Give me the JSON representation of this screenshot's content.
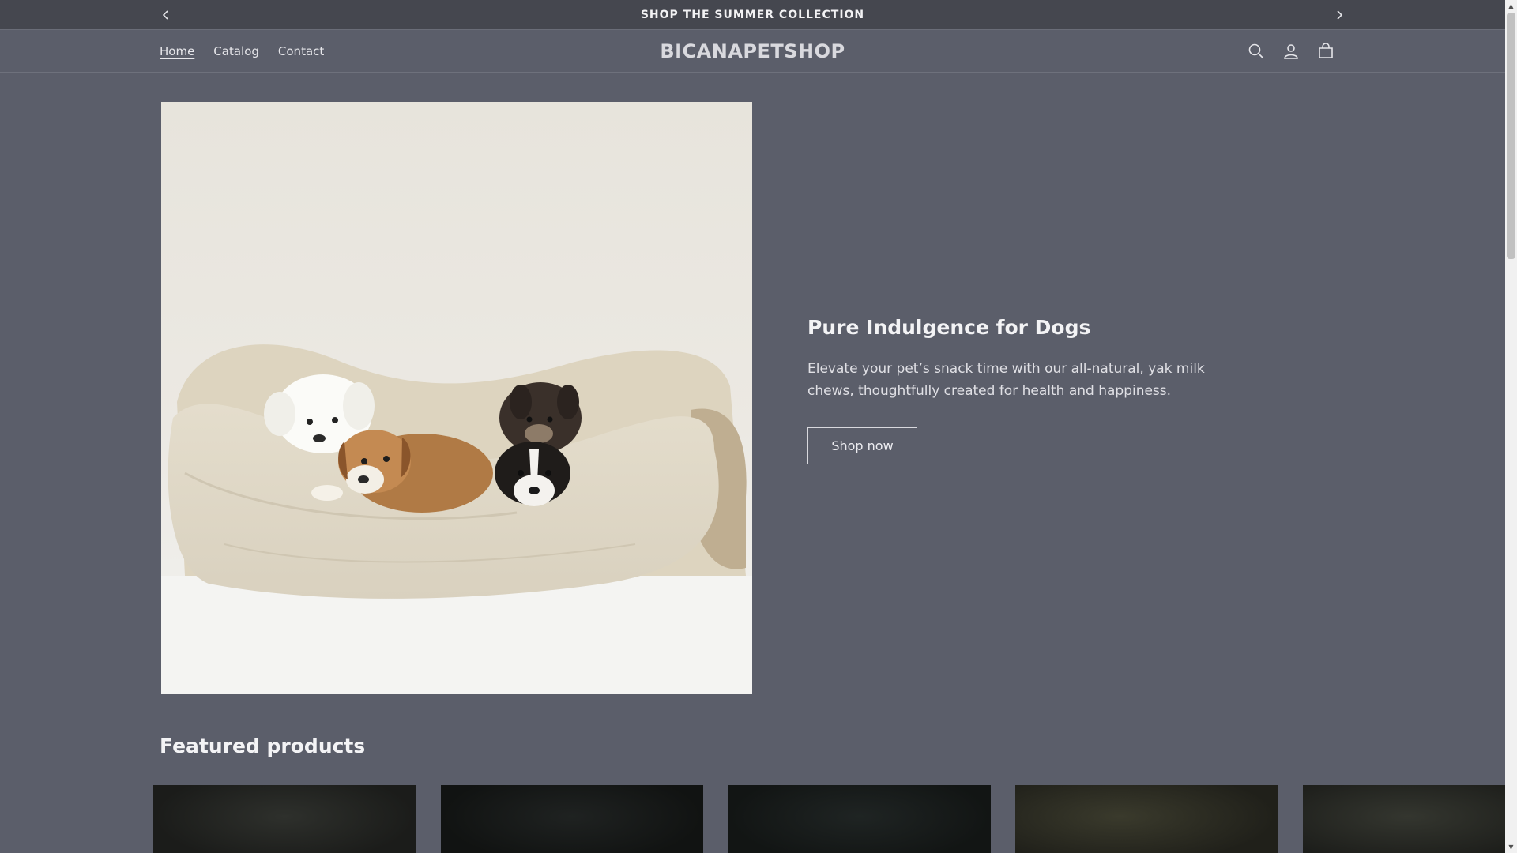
{
  "announcement": {
    "text": "SHOP THE SUMMER COLLECTION",
    "prev_icon": "chevron-left-icon",
    "next_icon": "chevron-right-icon"
  },
  "header": {
    "brand": "BICANAPETSHOP",
    "nav": [
      {
        "label": "Home",
        "active": true
      },
      {
        "label": "Catalog",
        "active": false
      },
      {
        "label": "Contact",
        "active": false
      }
    ],
    "icons": [
      "search-icon",
      "account-icon",
      "cart-icon"
    ]
  },
  "hero": {
    "title": "Pure Indulgence for Dogs",
    "description": "Elevate your pet’s snack time with our all-natural, yak milk chews, thoughtfully created for health and happiness.",
    "button_label": "Shop now",
    "image_subject": "four puppies lying in a cream pet bed"
  },
  "featured": {
    "title": "Featured products",
    "product_count_visible": 5
  },
  "colors": {
    "page_bg": "#5b5e6a",
    "announce_bg": "#45474f",
    "text": "#f3f3f5"
  }
}
